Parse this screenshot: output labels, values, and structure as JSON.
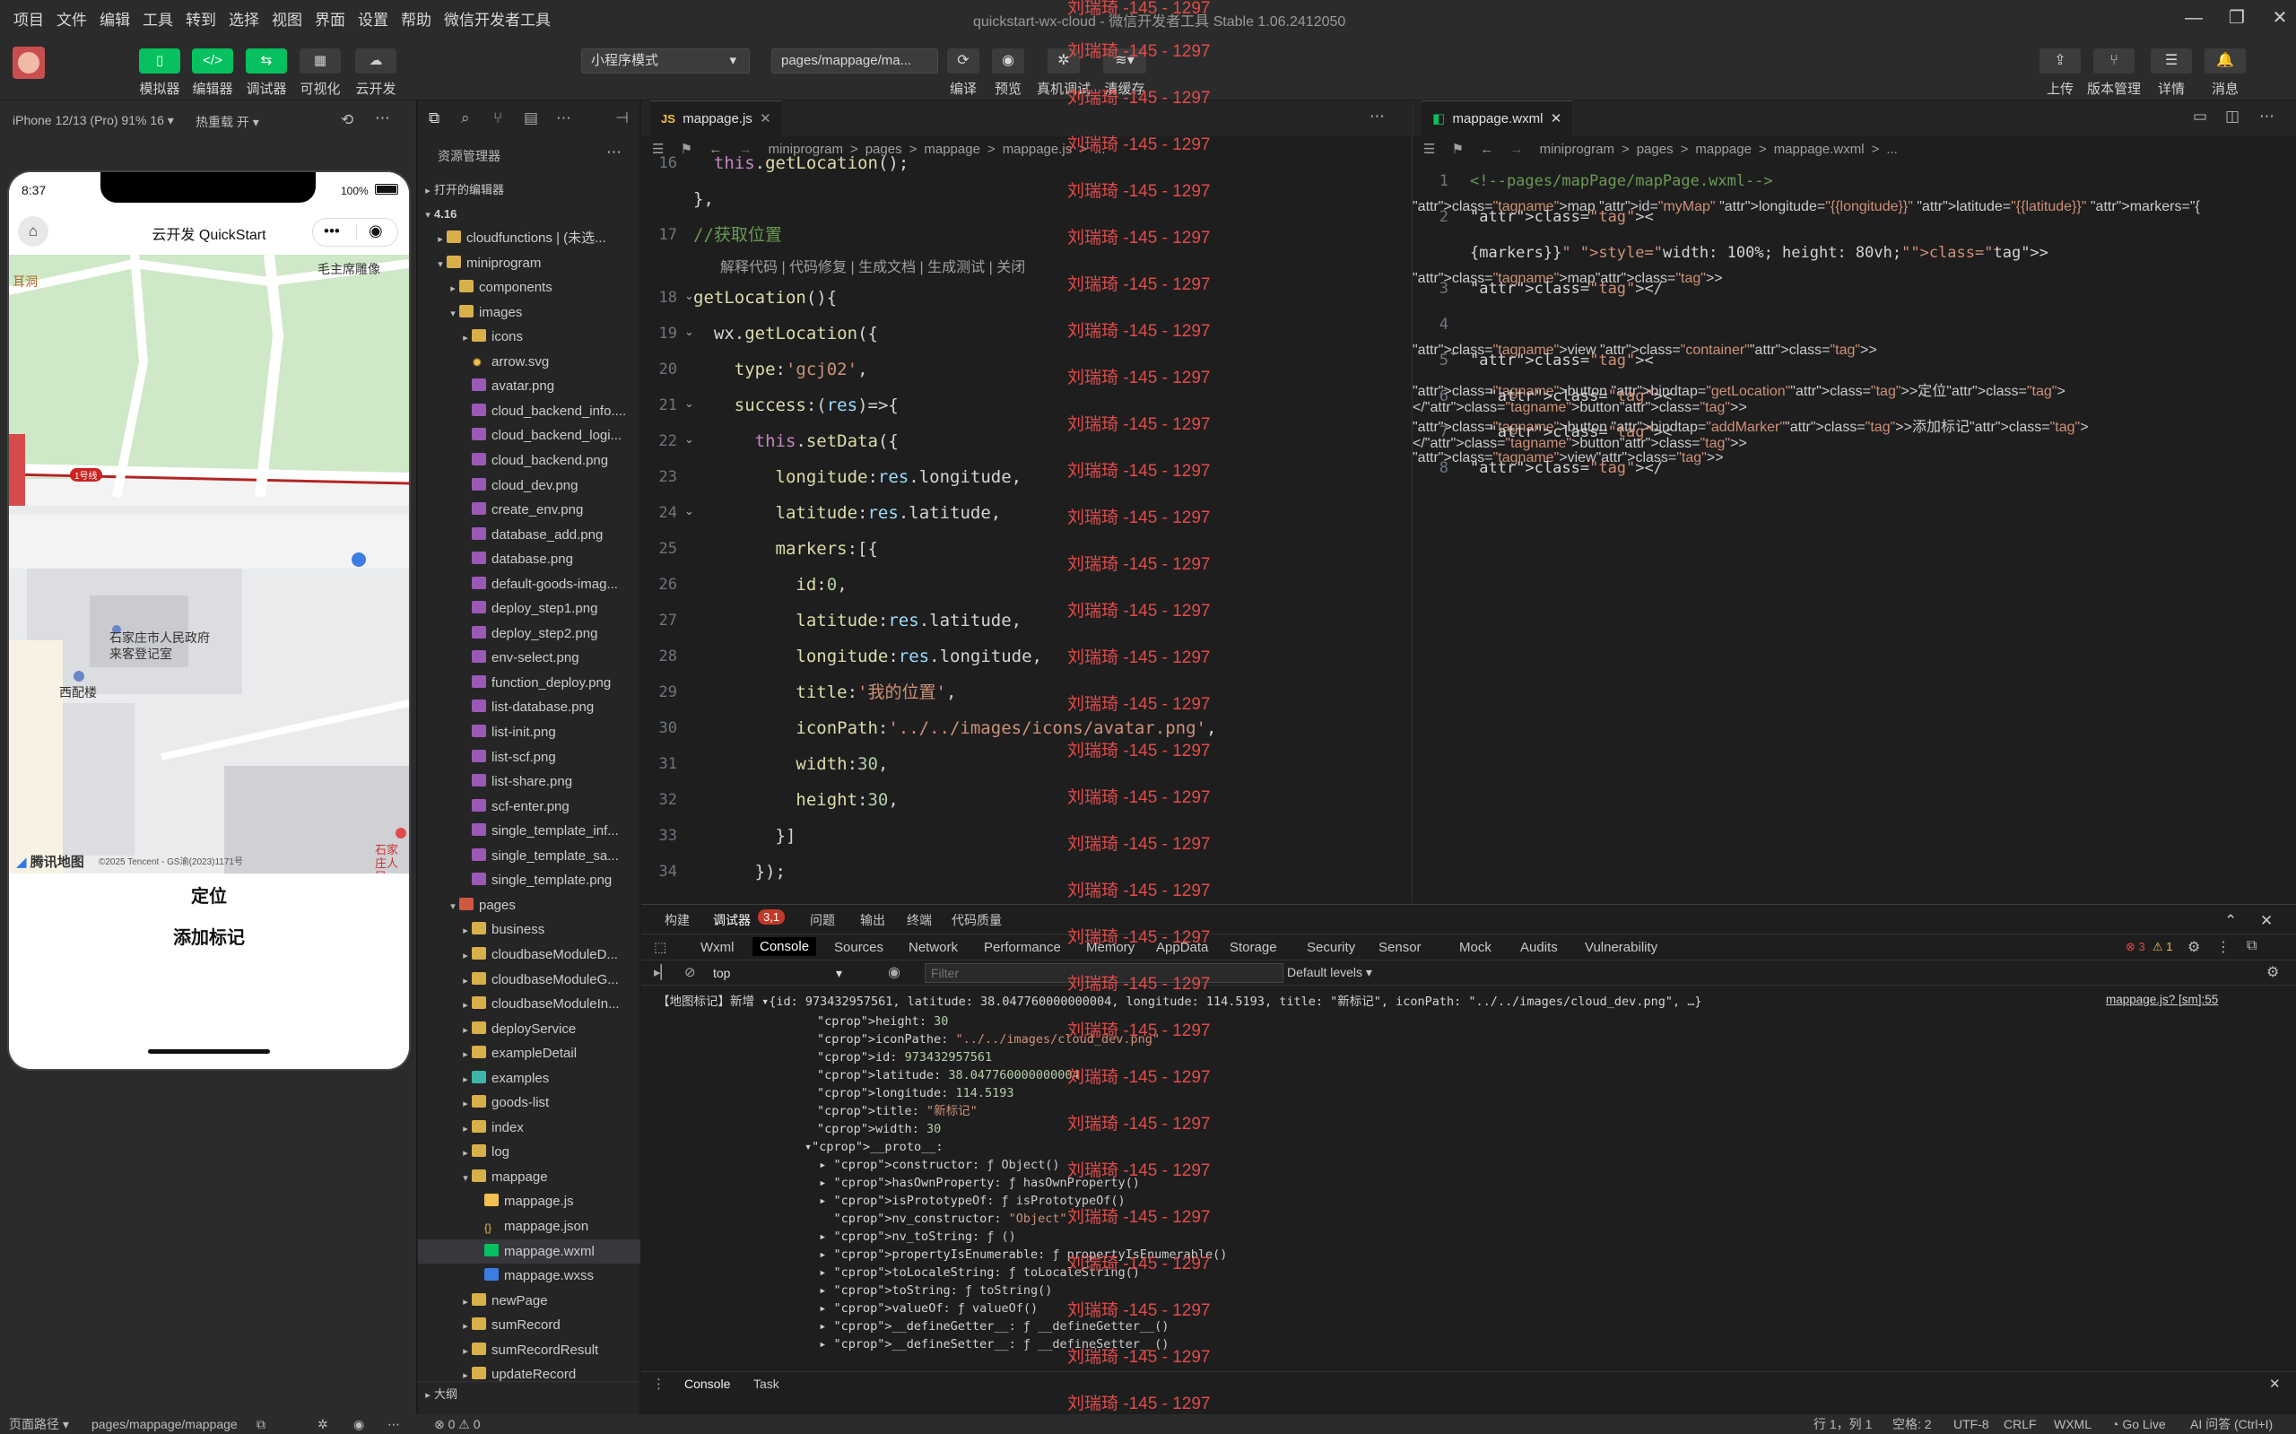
{
  "menu": [
    "项目",
    "文件",
    "编辑",
    "工具",
    "转到",
    "选择",
    "视图",
    "界面",
    "设置",
    "帮助",
    "微信开发者工具"
  ],
  "window_title": "quickstart-wx-cloud - 微信开发者工具 Stable 1.06.2412050",
  "toolbar": {
    "left_labels": [
      "模拟器",
      "编辑器",
      "调试器",
      "可视化",
      "云开发"
    ],
    "mode_select": "小程序模式",
    "page_select": "pages/mappage/ma...",
    "mid_labels": [
      "编译",
      "预览",
      "真机调试",
      "清缓存"
    ],
    "right_labels": [
      "上传",
      "版本管理",
      "详情",
      "消息"
    ]
  },
  "simulator": {
    "device": "iPhone 12/13 (Pro) 91% 16 ▾",
    "hot_reload": "热重载 开 ▾",
    "time": "8:37",
    "battery": "100%",
    "nav_title": "云开发 QuickStart",
    "map_labels": {
      "ear": "耳洞",
      "memorial": "毛主席雕像",
      "line": "1号线",
      "gov": "石家庄市人民政府来客登记室",
      "building": "西配楼",
      "east": "石家庄人民",
      "copyright": "©2025 Tencent - GS渝(2023)1171号",
      "logo": "腾讯地图"
    },
    "buttons": [
      "定位",
      "添加标记"
    ]
  },
  "explorer": {
    "title": "资源管理器",
    "open_editors": "打开的编辑器",
    "root": "4.16",
    "items": [
      {
        "name": "cloudfunctions | (未选...",
        "depth": 1,
        "type": "folder",
        "open": false
      },
      {
        "name": "miniprogram",
        "depth": 1,
        "type": "folder",
        "open": true
      },
      {
        "name": "components",
        "depth": 2,
        "type": "folder",
        "open": false
      },
      {
        "name": "images",
        "depth": 2,
        "type": "folder",
        "open": true
      },
      {
        "name": "icons",
        "depth": 3,
        "type": "folder",
        "open": false
      },
      {
        "name": "arrow.svg",
        "depth": 3,
        "type": "svg"
      },
      {
        "name": "avatar.png",
        "depth": 3,
        "type": "img"
      },
      {
        "name": "cloud_backend_info....",
        "depth": 3,
        "type": "img"
      },
      {
        "name": "cloud_backend_logi...",
        "depth": 3,
        "type": "img"
      },
      {
        "name": "cloud_backend.png",
        "depth": 3,
        "type": "img"
      },
      {
        "name": "cloud_dev.png",
        "depth": 3,
        "type": "img"
      },
      {
        "name": "create_env.png",
        "depth": 3,
        "type": "img"
      },
      {
        "name": "database_add.png",
        "depth": 3,
        "type": "img"
      },
      {
        "name": "database.png",
        "depth": 3,
        "type": "img"
      },
      {
        "name": "default-goods-imag...",
        "depth": 3,
        "type": "img"
      },
      {
        "name": "deploy_step1.png",
        "depth": 3,
        "type": "img"
      },
      {
        "name": "deploy_step2.png",
        "depth": 3,
        "type": "img"
      },
      {
        "name": "env-select.png",
        "depth": 3,
        "type": "img"
      },
      {
        "name": "function_deploy.png",
        "depth": 3,
        "type": "img"
      },
      {
        "name": "list-database.png",
        "depth": 3,
        "type": "img"
      },
      {
        "name": "list-init.png",
        "depth": 3,
        "type": "img"
      },
      {
        "name": "list-scf.png",
        "depth": 3,
        "type": "img"
      },
      {
        "name": "list-share.png",
        "depth": 3,
        "type": "img"
      },
      {
        "name": "scf-enter.png",
        "depth": 3,
        "type": "img"
      },
      {
        "name": "single_template_inf...",
        "depth": 3,
        "type": "img"
      },
      {
        "name": "single_template_sa...",
        "depth": 3,
        "type": "img"
      },
      {
        "name": "single_template.png",
        "depth": 3,
        "type": "img"
      },
      {
        "name": "pages",
        "depth": 2,
        "type": "folder-red",
        "open": true
      },
      {
        "name": "business",
        "depth": 3,
        "type": "folder",
        "open": false
      },
      {
        "name": "cloudbaseModuleD...",
        "depth": 3,
        "type": "folder",
        "open": false
      },
      {
        "name": "cloudbaseModuleG...",
        "depth": 3,
        "type": "folder",
        "open": false
      },
      {
        "name": "cloudbaseModuleIn...",
        "depth": 3,
        "type": "folder",
        "open": false
      },
      {
        "name": "deployService",
        "depth": 3,
        "type": "folder",
        "open": false
      },
      {
        "name": "exampleDetail",
        "depth": 3,
        "type": "folder",
        "open": false
      },
      {
        "name": "examples",
        "depth": 3,
        "type": "folder-teal",
        "open": false
      },
      {
        "name": "goods-list",
        "depth": 3,
        "type": "folder",
        "open": false
      },
      {
        "name": "index",
        "depth": 3,
        "type": "folder",
        "open": false
      },
      {
        "name": "log",
        "depth": 3,
        "type": "folder",
        "open": false
      },
      {
        "name": "mappage",
        "depth": 3,
        "type": "folder",
        "open": true
      },
      {
        "name": "mappage.js",
        "depth": 4,
        "type": "js"
      },
      {
        "name": "mappage.json",
        "depth": 4,
        "type": "json"
      },
      {
        "name": "mappage.wxml",
        "depth": 4,
        "type": "wxml",
        "selected": true
      },
      {
        "name": "mappage.wxss",
        "depth": 4,
        "type": "wxss"
      },
      {
        "name": "newPage",
        "depth": 3,
        "type": "folder",
        "open": false
      },
      {
        "name": "sumRecord",
        "depth": 3,
        "type": "folder",
        "open": false
      },
      {
        "name": "sumRecordResult",
        "depth": 3,
        "type": "folder",
        "open": false
      },
      {
        "name": "updateRecord",
        "depth": 3,
        "type": "folder",
        "open": false
      }
    ],
    "outline": "大纲"
  },
  "editor_js": {
    "tab": "mappage.js",
    "crumbs": [
      "miniprogram",
      ">",
      "pages",
      ">",
      "mappage",
      ">",
      "mappage.js",
      ">",
      "..."
    ],
    "codelens": "解释代码 | 代码修复 | 生成文档 | 生成测试 | 关闭",
    "lines": [
      {
        "n": "16",
        "code": "  this.getLocation();"
      },
      {
        "n": "",
        "code": "},"
      },
      {
        "n": "17",
        "code": "//获取位置"
      },
      {
        "n": "18",
        "code": "getLocation(){"
      },
      {
        "n": "19",
        "code": "  wx.getLocation({"
      },
      {
        "n": "20",
        "code": "    type:'gcj02',"
      },
      {
        "n": "21",
        "code": "    success:(res)=>{"
      },
      {
        "n": "22",
        "code": "      this.setData({"
      },
      {
        "n": "23",
        "code": "        longitude:res.longitude,"
      },
      {
        "n": "24",
        "code": "        latitude:res.latitude,"
      },
      {
        "n": "25",
        "code": "        markers:[{"
      },
      {
        "n": "26",
        "code": "          id:0,"
      },
      {
        "n": "27",
        "code": "          latitude:res.latitude,"
      },
      {
        "n": "28",
        "code": "          longitude:res.longitude,"
      },
      {
        "n": "29",
        "code": "          title:'我的位置',"
      },
      {
        "n": "30",
        "code": "          iconPath:'../../images/icons/avatar.png',"
      },
      {
        "n": "31",
        "code": "          width:30,"
      },
      {
        "n": "32",
        "code": "          height:30,"
      },
      {
        "n": "33",
        "code": "        }]"
      },
      {
        "n": "34",
        "code": "      });"
      }
    ]
  },
  "editor_wxml": {
    "tab": "mappage.wxml",
    "crumbs": [
      "miniprogram",
      ">",
      "pages",
      ">",
      "mappage",
      ">",
      "mappage.wxml",
      ">",
      "..."
    ],
    "lines": [
      {
        "n": "1",
        "code": "<!--pages/mapPage/mapPage.wxml-->"
      },
      {
        "n": "2",
        "code": "<map id=\"myMap\" longitude=\"{{longitude}}\" latitude=\"{{latitude}}\" markers=\"{"
      },
      {
        "n": "",
        "code": "{markers}}\" style=\"width: 100%; height: 80vh;\">"
      },
      {
        "n": "3",
        "code": "</map>"
      },
      {
        "n": "4",
        "code": ""
      },
      {
        "n": "5",
        "code": "<view class=\"container\">"
      },
      {
        "n": "6",
        "code": "  <button bindtap=\"getLocation\">定位</button>"
      },
      {
        "n": "7",
        "code": "  <button bindtap=\"addMarker\">添加标记</button>"
      },
      {
        "n": "8",
        "code": "</view>"
      }
    ]
  },
  "devtools": {
    "top_tabs": [
      "构建",
      "调试器",
      "问题",
      "输出",
      "终端",
      "代码质量"
    ],
    "debugger_badge": "3,1",
    "panel_tabs": [
      "Wxml",
      "Console",
      "Sources",
      "Network",
      "Performance",
      "Memory",
      "AppData",
      "Storage",
      "Security",
      "Sensor",
      "Mock",
      "Audits",
      "Vulnerability"
    ],
    "errors": "3",
    "warnings": "1",
    "context": "top",
    "filter_placeholder": "Filter",
    "levels": "Default levels ▾",
    "log_header": "【地图标记】新增 ▾{id: 973432957561, latitude: 38.047760000000004, longitude: 114.5193, title: \"新标记\", iconPath: \"../../images/cloud_dev.png\", …}",
    "log_source": "mappage.js? [sm]:55",
    "log_lines": [
      "height: 30",
      "iconPathe: \"../../images/cloud_dev.png\"",
      "id: 973432957561",
      "latitude: 38.047760000000004",
      "longitude: 114.5193",
      "title: \"新标记\"",
      "width: 30",
      "▾__proto__:",
      "  ▸ constructor: ƒ Object()",
      "  ▸ hasOwnProperty: ƒ hasOwnProperty()",
      "  ▸ isPrototypeOf: ƒ isPrototypeOf()",
      "    nv_constructor: \"Object\"",
      "  ▸ nv_toString: ƒ ()",
      "  ▸ propertyIsEnumerable: ƒ propertyIsEnumerable()",
      "  ▸ toLocaleString: ƒ toLocaleString()",
      "  ▸ toString: ƒ toString()",
      "  ▸ valueOf: ƒ valueOf()",
      "  ▸ __defineGetter__: ƒ __defineGetter__()",
      "  ▸ __defineSetter__: ƒ __defineSetter__()"
    ],
    "bottom_tabs": [
      "Console",
      "Task"
    ]
  },
  "watermark": "刘瑞琦 -145 - 1297",
  "statusbar": {
    "page_path_label": "页面路径 ▾",
    "page_path": "pages/mappage/mappage",
    "problems": "⊗ 0 ⚠ 0",
    "position": "行 1，列 1",
    "spaces": "空格: 2",
    "encoding": "UTF-8",
    "eol": "CRLF",
    "lang": "WXML",
    "golive": "Go Live",
    "ai": "AI 问答 (Ctrl+I)"
  },
  "colors": {
    "accent_green": "#07c160",
    "watermark": "#e24b4b",
    "selection": "#37373d"
  }
}
